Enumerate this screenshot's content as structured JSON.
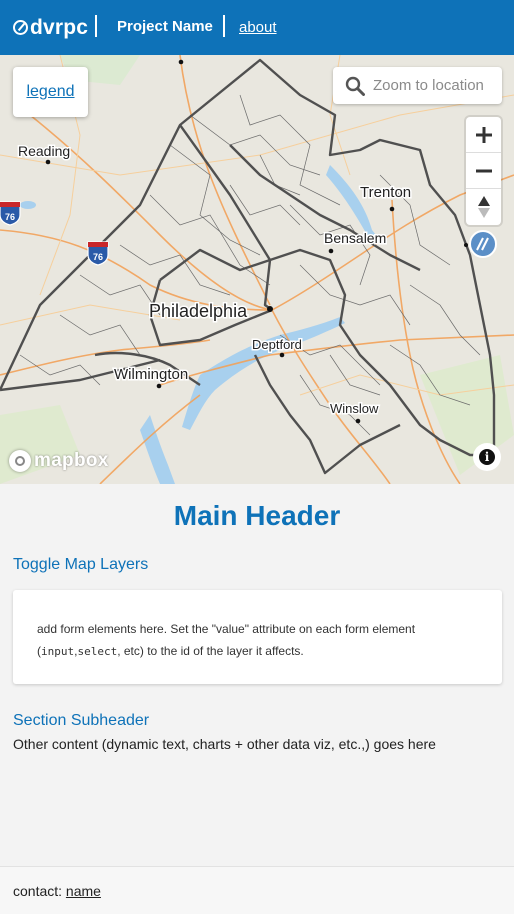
{
  "nav": {
    "logo_text": "dvrpc",
    "project_name": "Project Name",
    "about_label": "about",
    "background": "#0e72b8"
  },
  "map": {
    "legend_label": "legend",
    "search_placeholder": "Zoom to location",
    "controls": {
      "zoom_in": "+",
      "zoom_out": "−",
      "compass_icon": "compass-icon"
    },
    "attribution_logo": "mapbox",
    "info_label": "i",
    "city_labels": [
      "Reading",
      "Trenton",
      "Bensalem",
      "Philadelphia",
      "Deptford",
      "Wilmington",
      "Winslow"
    ],
    "interstate_shields": [
      "76",
      "76"
    ]
  },
  "content": {
    "main_header": "Main Header",
    "toggle_header": "Toggle Map Layers",
    "card_text_before": "add form elements here. Set the \"value\" attribute on each form element (",
    "card_code_1": "input",
    "card_comma": ",",
    "card_code_2": "select",
    "card_text_after": ", etc) to the id of the layer it affects.",
    "section_subheader": "Section Subheader",
    "section_text": "Other content (dynamic text, charts + other data viz, etc.,) goes here"
  },
  "footer": {
    "contact_label": "contact:",
    "contact_link": "name"
  },
  "colors": {
    "accent": "#0e72b8",
    "region_outline": "#505050",
    "water": "#a8d0ee",
    "road_major": "#f2a25a"
  }
}
